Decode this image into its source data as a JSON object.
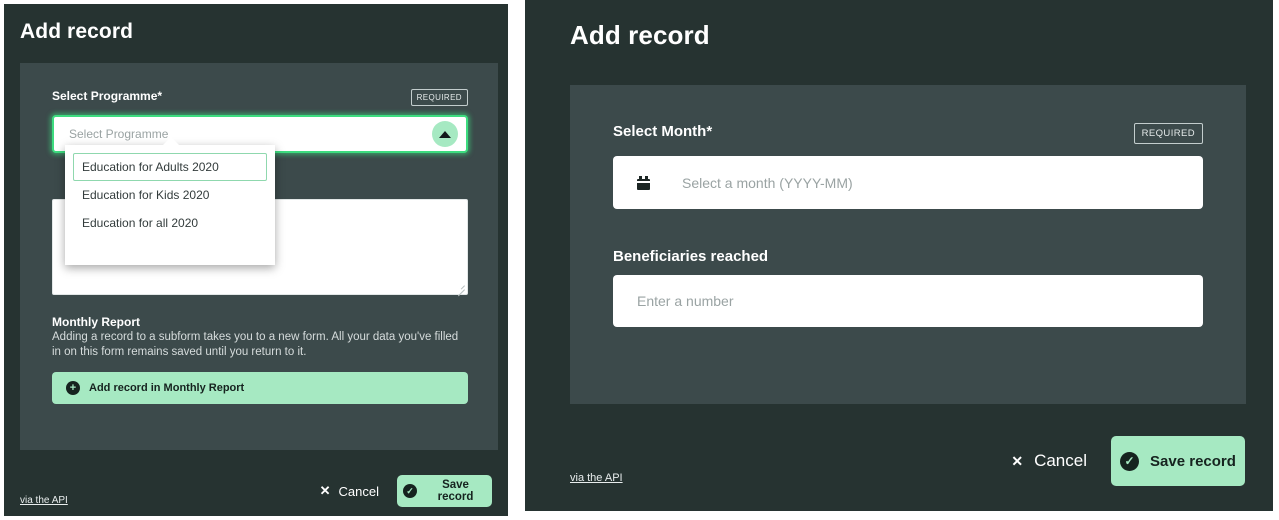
{
  "left_panel": {
    "title": "Add record",
    "programme_field": {
      "label": "Select Programme*",
      "badge": "REQUIRED",
      "placeholder": "Select Programme",
      "toggle_icon": "caret-up-icon",
      "options": [
        "Education for Adults 2020",
        "Education for Kids 2020",
        "Education for all 2020"
      ],
      "active_option": "Education for Adults 2020"
    },
    "subform": {
      "title": "Monthly Report",
      "description": "Adding a record to a subform takes you to a new form. All your data you've filled in on this form remains saved until you return to it.",
      "button_label": "Add record in Monthly Report",
      "button_icon": "plus-circle-icon"
    },
    "footer": {
      "api_link": "via the API",
      "cancel_label": "Cancel",
      "cancel_icon": "close-x-icon",
      "save_label": "Save record",
      "save_icon": "check-circle-icon"
    }
  },
  "right_panel": {
    "title": "Add record",
    "month_field": {
      "label": "Select Month*",
      "badge": "REQUIRED",
      "placeholder": "Select a month (YYYY-MM)",
      "icon": "calendar-icon"
    },
    "beneficiaries_field": {
      "label": "Beneficiaries reached",
      "placeholder": "Enter a number"
    },
    "footer": {
      "api_link": "via the API",
      "cancel_label": "Cancel",
      "cancel_icon": "close-x-icon",
      "save_label": "Save record",
      "save_icon": "check-circle-icon"
    }
  },
  "colors": {
    "panel_bg": "#263331",
    "card_bg": "#3c4a4b",
    "accent_green": "#a6e9c2",
    "focus_green": "#3ddc7f",
    "text_light": "#ffffff",
    "placeholder": "#9aa3a3"
  }
}
